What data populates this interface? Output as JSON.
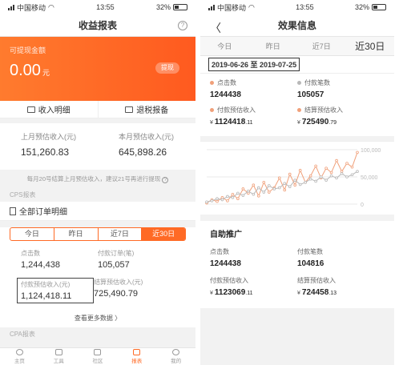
{
  "colors": {
    "accent": "#ff6a25",
    "series_orange": "#f0a07a",
    "series_grey": "#b8b8b8"
  },
  "left": {
    "status": {
      "carrier": "中国移动",
      "time": "13:55",
      "battery": "32%"
    },
    "title": "收益报表",
    "help_icon": "?",
    "balance": {
      "label": "可提现金额",
      "amount": "0.00",
      "unit": "元",
      "withdraw": "提现"
    },
    "actions": [
      {
        "icon": "wallet-icon",
        "label": "收入明细"
      },
      {
        "icon": "mail-icon",
        "label": "退税报备"
      }
    ],
    "estimates": [
      {
        "label": "上月预估收入(元)",
        "value": "151,260.83"
      },
      {
        "label": "本月预估收入(元)",
        "value": "645,898.26"
      }
    ],
    "note": "每月20号结算上月预估收入，建议21号再进行提现",
    "cps_label": "CPS报表",
    "all_orders": "全部订单明细",
    "tabs": [
      "今日",
      "昨日",
      "近7日",
      "近30日"
    ],
    "active_tab": 3,
    "metrics": [
      {
        "label": "点击数",
        "value": "1,244,438"
      },
      {
        "label": "付款订单(笔)",
        "value": "105,057"
      },
      {
        "label": "付款预估收入(元)",
        "value": "1,124,418.11"
      },
      {
        "label": "结算预估收入(元)",
        "value": "725,490.79"
      }
    ],
    "more": "查看更多数据 〉",
    "cpa_label": "CPA报表",
    "tabbar": [
      "主页",
      "工具",
      "社区",
      "报表",
      "我的"
    ],
    "tabbar_active": 3
  },
  "right": {
    "status": {
      "carrier": "中国移动",
      "time": "13:55",
      "battery": "32%"
    },
    "title": "效果信息",
    "back": "〈",
    "tabs": [
      "今日",
      "昨日",
      "近7日",
      "近30日"
    ],
    "active_tab": 3,
    "date_range": "2019-06-26 至 2019-07-25",
    "stats": [
      {
        "label": "点击数",
        "dot": "#f0a07a",
        "value": "1244438"
      },
      {
        "label": "付款笔数",
        "dot": "#b8b8b8",
        "value": "105057"
      },
      {
        "label": "付款预估收入",
        "dot": "#f0a07a",
        "currency": "¥",
        "value": "1124418",
        "decimal": ".11"
      },
      {
        "label": "结算预估收入",
        "dot": "#f0a07a",
        "currency": "¥",
        "value": "725490",
        "decimal": ".79"
      }
    ],
    "promo": {
      "title": "自助推广",
      "stats": [
        {
          "label": "点击数",
          "value": "1244438"
        },
        {
          "label": "付款笔数",
          "value": "104816"
        },
        {
          "label": "付款预估收入",
          "currency": "¥",
          "value": "1123069",
          "decimal": ".11"
        },
        {
          "label": "结算预估收入",
          "currency": "¥",
          "value": "724458",
          "decimal": ".13"
        }
      ]
    }
  },
  "chart_data": {
    "type": "line",
    "title": "",
    "xlabel": "",
    "ylabel": "",
    "ylim": [
      0,
      100000
    ],
    "y_ticks": [
      "0",
      "50,000",
      "100,000"
    ],
    "grid": true,
    "series": [
      {
        "values": [
          2,
          8,
          5,
          12,
          6,
          18,
          10,
          28,
          20,
          35,
          15,
          40,
          22,
          30,
          48,
          26,
          55,
          35,
          62,
          40,
          52,
          70,
          48,
          66,
          58,
          80,
          60,
          75,
          68,
          95
        ]
      },
      {
        "values": [
          4,
          6,
          10,
          8,
          14,
          12,
          20,
          16,
          24,
          18,
          30,
          22,
          34,
          28,
          30,
          38,
          32,
          44,
          36,
          40,
          46,
          42,
          50,
          44,
          52,
          48,
          56,
          50,
          54,
          60
        ]
      }
    ]
  }
}
